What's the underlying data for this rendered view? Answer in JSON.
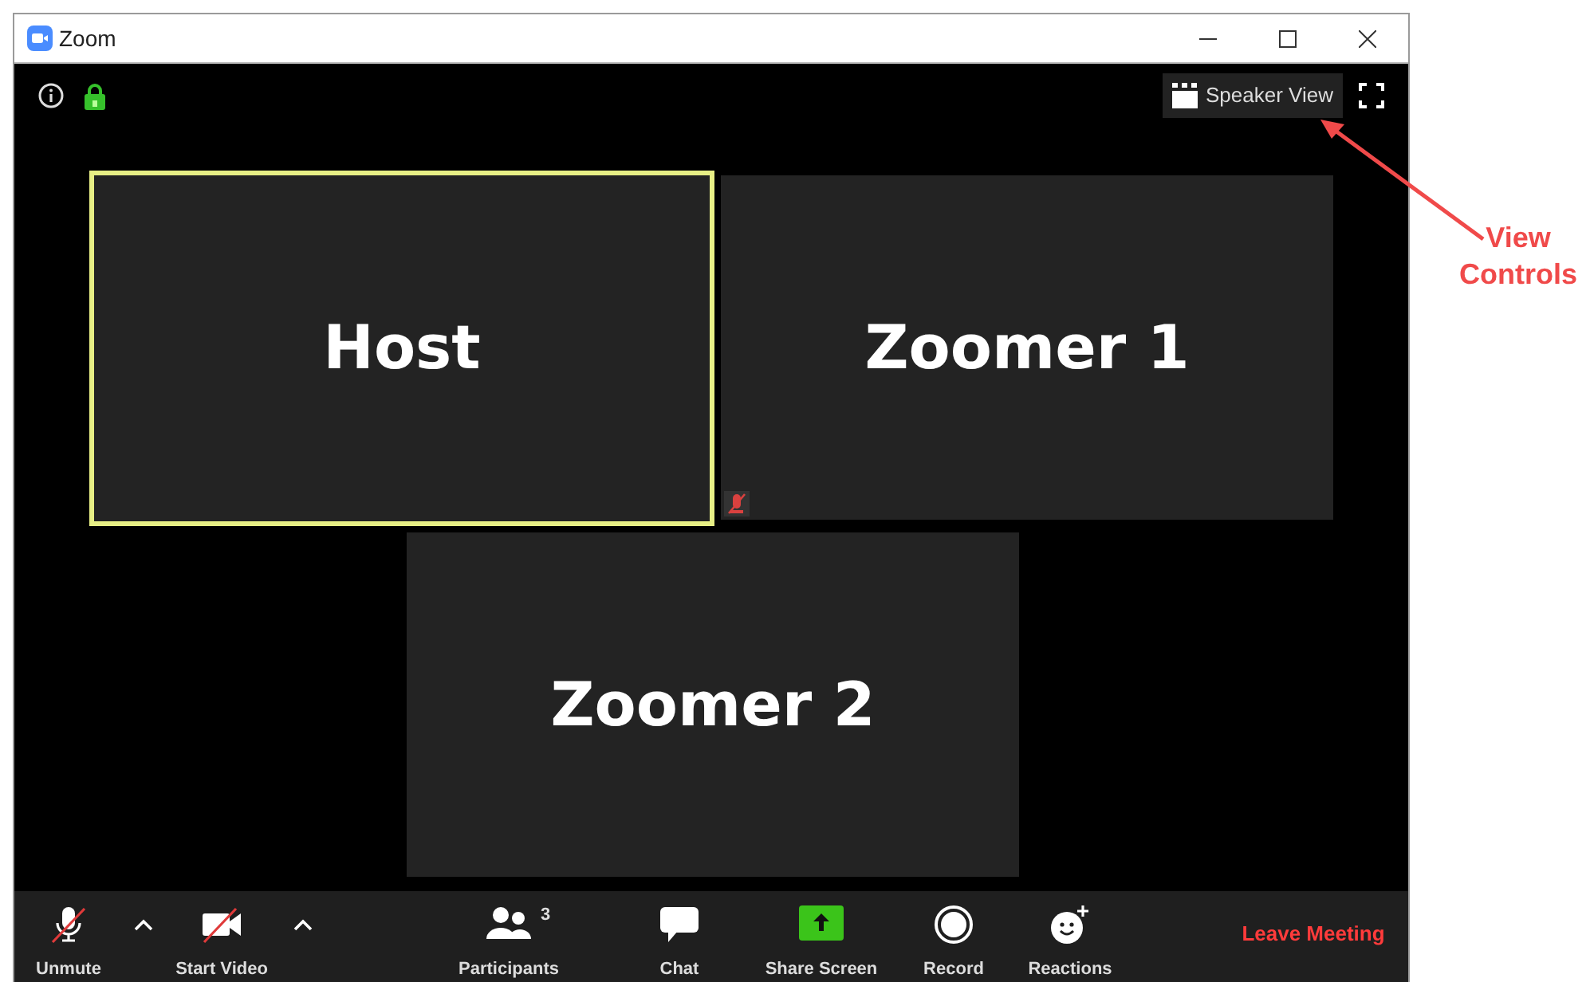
{
  "window": {
    "title": "Zoom"
  },
  "top_bar": {
    "view_button": "Speaker View"
  },
  "tiles": [
    {
      "name": "Host",
      "speaking": true,
      "muted": false
    },
    {
      "name": "Zoomer 1",
      "speaking": false,
      "muted": true
    },
    {
      "name": "Zoomer 2",
      "speaking": false,
      "muted": false
    }
  ],
  "toolbar": [
    {
      "kind": "mic",
      "label": "Unmute",
      "muted": true
    },
    {
      "kind": "caret"
    },
    {
      "kind": "video",
      "label": "Start Video",
      "muted": true
    },
    {
      "kind": "caret"
    },
    {
      "kind": "participants",
      "label": "Participants",
      "count": "3"
    },
    {
      "kind": "chat",
      "label": "Chat"
    },
    {
      "kind": "share",
      "label": "Share Screen"
    },
    {
      "kind": "record",
      "label": "Record"
    },
    {
      "kind": "reactions",
      "label": "Reactions"
    },
    {
      "kind": "leave",
      "label": "Leave Meeting"
    }
  ],
  "annotation": {
    "text": "View Controls"
  }
}
